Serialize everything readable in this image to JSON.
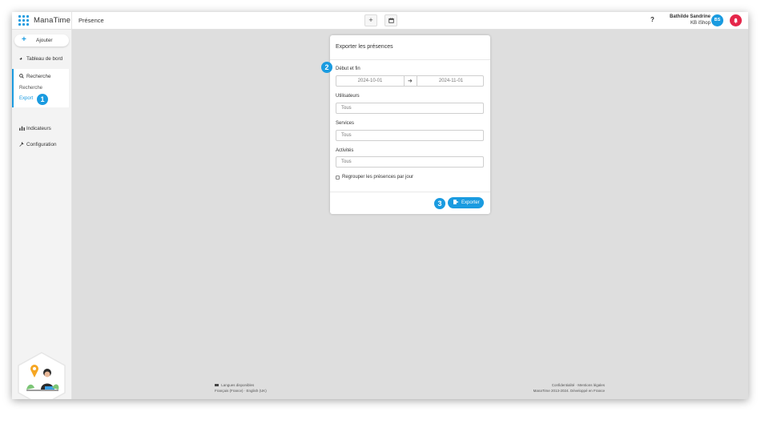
{
  "app": {
    "name": "ManaTime",
    "page_title": "Présence"
  },
  "topbar": {
    "add_label": "+",
    "help_label": "?"
  },
  "user": {
    "name": "Bathilde Sandrine",
    "company": "KB iShop",
    "initials": "BS"
  },
  "sidebar": {
    "add_label": "Ajouter",
    "dashboard_label": "Tableau de bord",
    "search_label": "Recherche",
    "search_sub_1": "Recherche",
    "search_sub_2": "Export",
    "indicators_label": "Indicateurs",
    "configuration_label": "Configuration"
  },
  "markers": {
    "m1": "1",
    "m2": "2",
    "m3": "3"
  },
  "panel": {
    "title": "Exporter les présences",
    "period_label": "Début et fin",
    "date_start": "2024-10-01",
    "date_end": "2024-11-01",
    "users_label": "Utilisateurs",
    "users_value": "Tous",
    "services_label": "Services",
    "services_value": "Tous",
    "activities_label": "Activités",
    "activities_value": "Tous",
    "group_label": "Regrouper les présences par jour",
    "export_label": "Exporter"
  },
  "footer": {
    "languages_title": "Langues disponibles",
    "languages_list": "Français (France) · English (UK)",
    "legal": "Confidentialité · Mentions légales",
    "copyright": "ManaTime 2013-2024. Développé en France"
  },
  "colors": {
    "accent": "#1a9be0",
    "alert": "#e5264a"
  }
}
